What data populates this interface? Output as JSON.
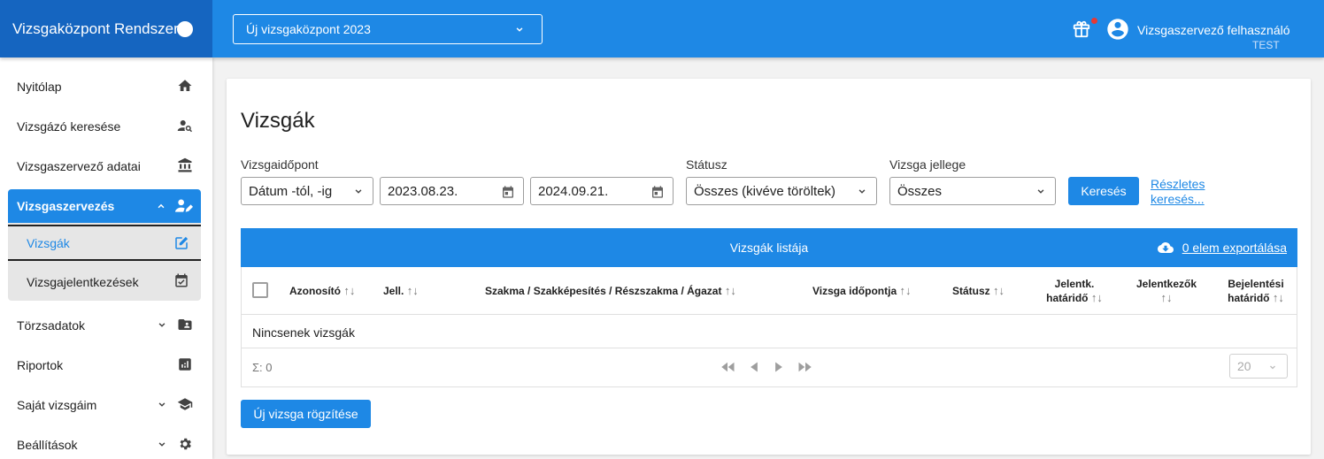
{
  "app": {
    "brand": "Vizsgaközpont Rendszer"
  },
  "header": {
    "center_select": "Új vizsgaközpont 2023",
    "user_name": "Vizsgaszervező felhasználó",
    "user_role": "TEST"
  },
  "sidebar": {
    "items": [
      {
        "label": "Nyitólap",
        "icon": "home-icon"
      },
      {
        "label": "Vizsgázó keresése",
        "icon": "person-search-icon"
      },
      {
        "label": "Vizsgaszervező adatai",
        "icon": "bank-icon"
      },
      {
        "label": "Vizsgaszervezés",
        "icon": "person-edit-icon"
      },
      {
        "label": "Törzsadatok",
        "icon": "folder-person-icon"
      },
      {
        "label": "Riportok",
        "icon": "report-icon"
      },
      {
        "label": "Saját vizsgáim",
        "icon": "graduation-cap-icon"
      },
      {
        "label": "Beállítások",
        "icon": "gear-icon"
      }
    ],
    "sub_items": [
      {
        "label": "Vizsgák",
        "icon": "edit-square-icon"
      },
      {
        "label": "Vizsgajelentkezések",
        "icon": "calendar-check-icon"
      }
    ]
  },
  "main": {
    "title": "Vizsgák",
    "filters": {
      "date_label": "Vizsgaidőpont",
      "date_mode": "Dátum -tól, -ig",
      "date_from": "2023.08.23.",
      "date_to": "2024.09.21.",
      "status_label": "Státusz",
      "status_value": "Összes (kivéve töröltek)",
      "type_label": "Vizsga jellege",
      "type_value": "Összes",
      "search_button": "Keresés",
      "advanced_line1": "Részletes",
      "advanced_line2": "keresés..."
    },
    "table": {
      "title": "Vizsgák listája",
      "export": "0 elem exportálása",
      "columns": [
        {
          "l1": "Azonosító",
          "l2": ""
        },
        {
          "l1": "Jell.",
          "l2": ""
        },
        {
          "l1": "Szakma / Szakképesítés / Részszakma / Ágazat",
          "l2": ""
        },
        {
          "l1": "Vizsga időpontja",
          "l2": ""
        },
        {
          "l1": "Státusz",
          "l2": ""
        },
        {
          "l1": "Jelentk.",
          "l2": "határidő"
        },
        {
          "l1": "Jelentkezők",
          "l2": ""
        },
        {
          "l1": "Bejelentési",
          "l2": "határidő"
        }
      ],
      "sort_glyph": "↑↓",
      "empty_text": "Nincsenek vizsgák",
      "sum_text": "Σ: 0",
      "page_size": "20"
    },
    "new_button": "Új vizsga rögzítése"
  },
  "colors": {
    "primary": "#1e88e5",
    "brand_dark": "#1565c0",
    "notification": "#e53935"
  }
}
